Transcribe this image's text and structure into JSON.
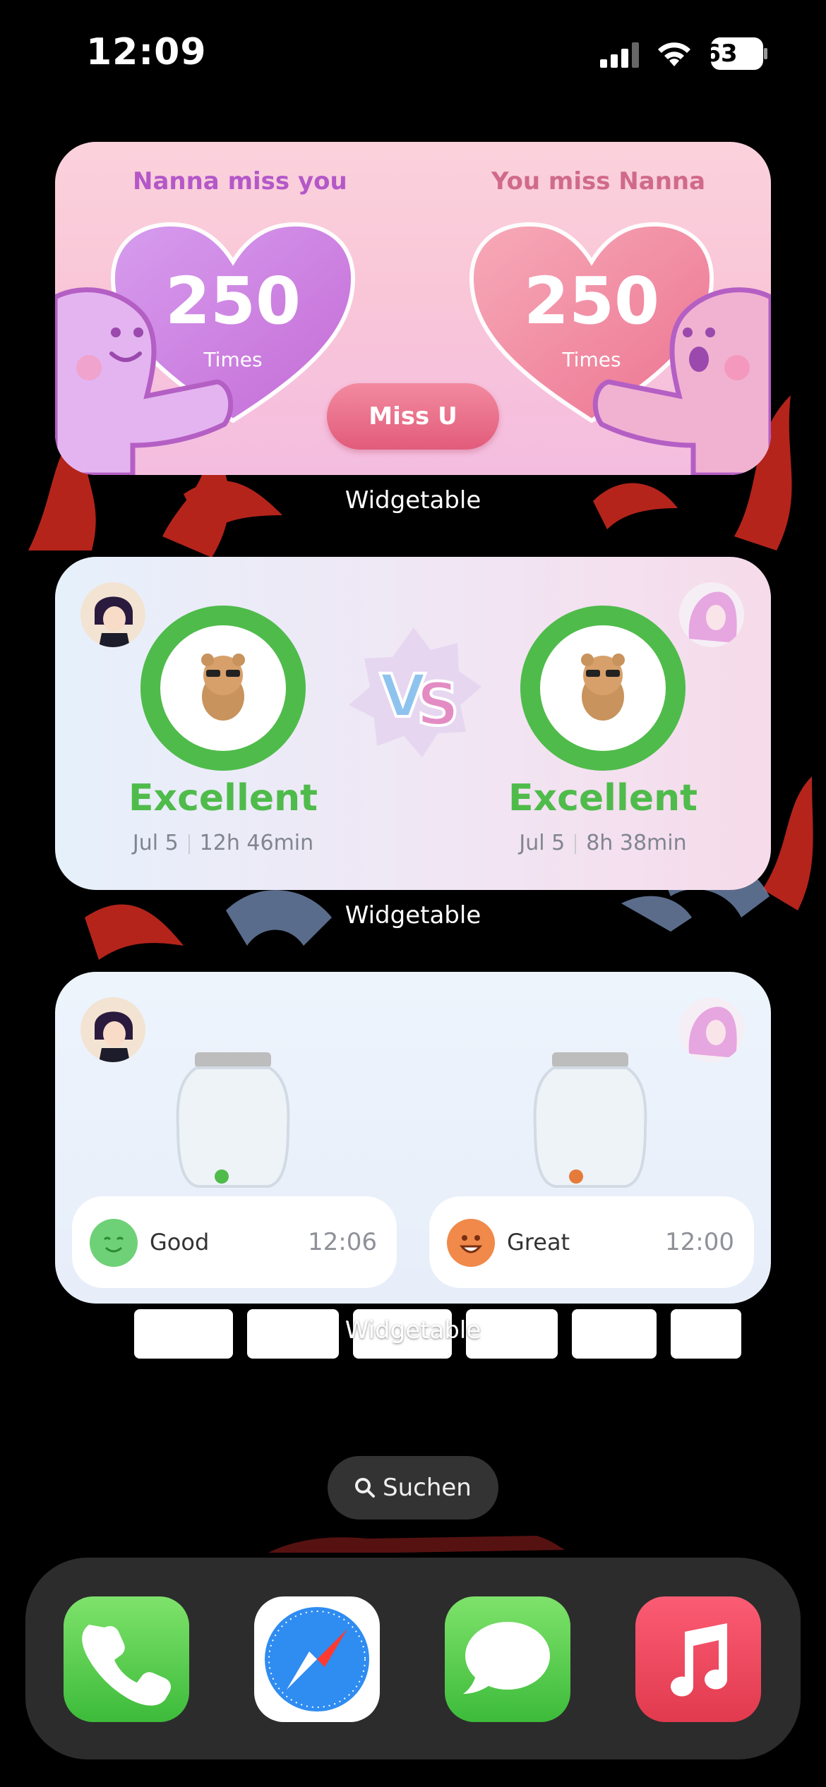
{
  "status_bar": {
    "time": "12:09",
    "battery_level": "63"
  },
  "widgets": [
    {
      "app_label": "Widgetable",
      "left": {
        "title": "Nanna miss you",
        "count": "250",
        "unit": "Times"
      },
      "right": {
        "title": "You miss Nanna",
        "count": "250",
        "unit": "Times"
      },
      "button_label": "Miss U"
    },
    {
      "app_label": "Widgetable",
      "vs_label": "VS",
      "left": {
        "rating": "Excellent",
        "date": "Jul 5",
        "duration": "12h 46min",
        "progress": 0.93
      },
      "right": {
        "rating": "Excellent",
        "date": "Jul 5",
        "duration": "8h 38min",
        "progress": 0.93
      }
    },
    {
      "app_label": "Widgetable",
      "left": {
        "mood": "Good",
        "time": "12:06",
        "jar_ball_color": "#4fbb4b"
      },
      "right": {
        "mood": "Great",
        "time": "12:00",
        "jar_ball_color": "#e57b3a"
      }
    }
  ],
  "search": {
    "label": "Suchen"
  },
  "dock": [
    "Phone",
    "Safari",
    "Messages",
    "Music"
  ],
  "colors": {
    "accent_green": "#4fbb4b",
    "pink_button": "#e25b7a",
    "purple_title": "#b458c8",
    "pink_title": "#d06a8c"
  }
}
